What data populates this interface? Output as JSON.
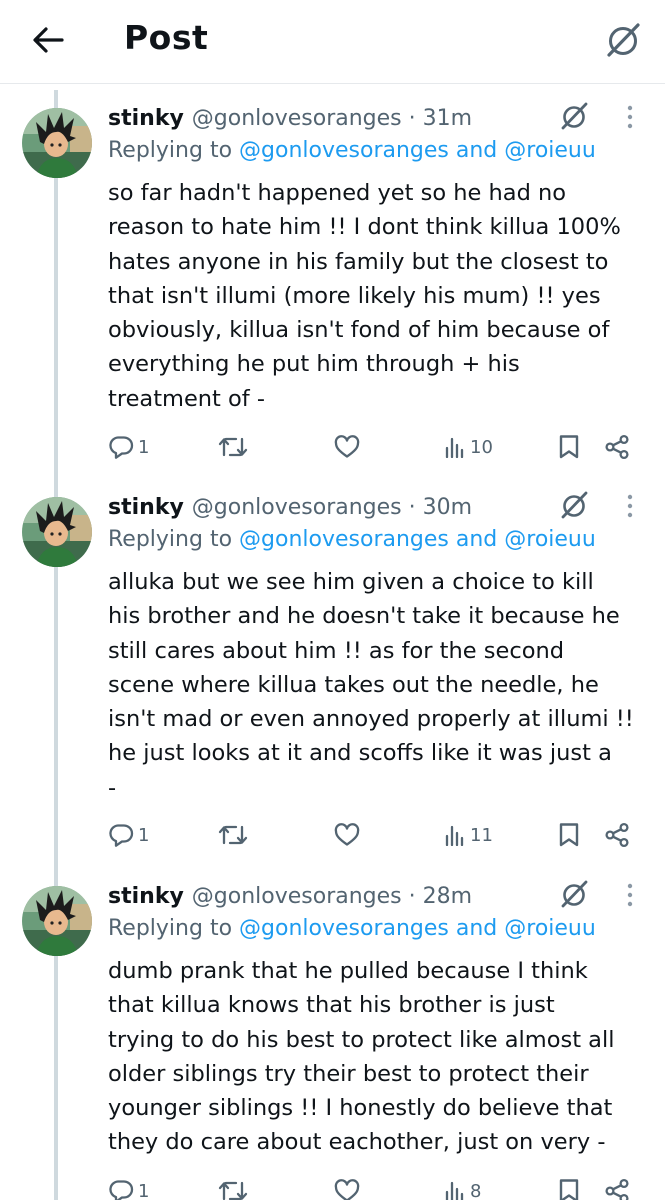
{
  "header": {
    "title": "Post"
  },
  "tweets": [
    {
      "name": "stinky",
      "handle": "@gonlovesoranges",
      "sep": " · ",
      "time": "31m",
      "reply_prefix": "Replying to ",
      "reply_mentions": "@gonlovesoranges and @roieuu",
      "lines": [
        "so far hadn't happened yet so he had no",
        "reason to hate him !! I dont think killua 100%",
        "hates anyone in his family but the closest to",
        "that isn't illumi (more likely his mum) !! yes",
        "obviously, killua isn't fond of him because of",
        "everything he put him through + his",
        "treatment of -"
      ],
      "replies": "1",
      "views": "10"
    },
    {
      "name": "stinky",
      "handle": "@gonlovesoranges",
      "sep": " · ",
      "time": "30m",
      "reply_prefix": "Replying to ",
      "reply_mentions": "@gonlovesoranges and @roieuu",
      "lines": [
        "alluka but we see him given a choice to kill",
        "his brother and he doesn't take it because he",
        "still cares about him !! as for the second",
        "scene where killua takes out the needle, he",
        "isn't mad or even annoyed properly at illumi !!",
        "he just looks at it and scoffs like it was just a",
        "-"
      ],
      "replies": "1",
      "views": "11"
    },
    {
      "name": "stinky",
      "handle": "@gonlovesoranges",
      "sep": " · ",
      "time": "28m",
      "reply_prefix": "Replying to ",
      "reply_mentions": "@gonlovesoranges and @roieuu",
      "lines": [
        "dumb prank that he pulled because I think",
        "that killua knows that his brother is just",
        "trying to do his best to protect like almost all",
        "older siblings try their best to protect their",
        "younger siblings !! I honestly do believe that",
        "they do care about eachother, just on very -"
      ],
      "replies": "1",
      "views": "8"
    }
  ],
  "icons": {
    "back": "arrow-left-icon",
    "grok": "grok-icon",
    "more": "more-vertical-icon",
    "reply": "reply-icon",
    "repost": "repost-icon",
    "like": "heart-icon",
    "views": "views-icon",
    "bookmark": "bookmark-icon",
    "share": "share-icon"
  },
  "colors": {
    "text": "#0f1419",
    "secondary": "#536471",
    "link": "#1d9bf0",
    "thread_line": "#cfd9de"
  }
}
